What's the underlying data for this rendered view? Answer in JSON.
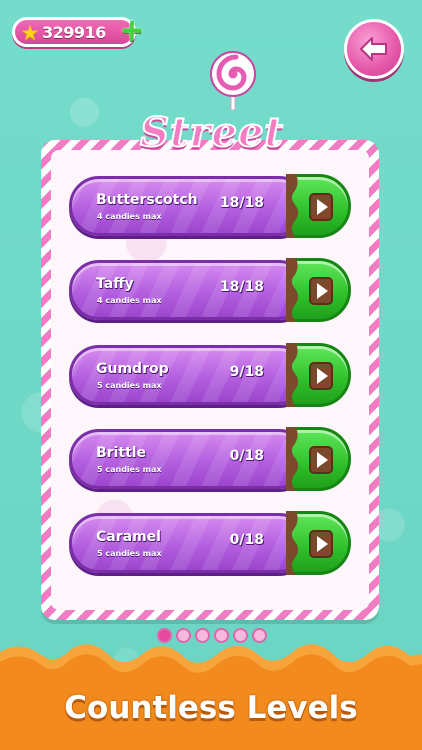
{
  "hud": {
    "coins": "329916",
    "star_icon": "star-icon",
    "plus_icon": "plus-icon",
    "back_icon": "back-arrow-icon"
  },
  "header": {
    "title": "Street",
    "logo_icon": "lollipop-icon"
  },
  "levels": [
    {
      "name": "Butterscotch",
      "subtitle": "4 candies max",
      "progress": "18/18"
    },
    {
      "name": "Taffy",
      "subtitle": "4 candies max",
      "progress": "18/18"
    },
    {
      "name": "Gumdrop",
      "subtitle": "5 candies max",
      "progress": "9/18"
    },
    {
      "name": "Brittle",
      "subtitle": "5 candies max",
      "progress": "0/18"
    },
    {
      "name": "Caramel",
      "subtitle": "5 candies max",
      "progress": "0/18"
    }
  ],
  "pagination": {
    "pages": 6,
    "current": 1
  },
  "footer": {
    "tagline": "Countless Levels"
  },
  "colors": {
    "background": "#6fd9c8",
    "panel_stripe": "#f07cc3",
    "pill": "#b35fdf",
    "play": "#2fc02a",
    "caramel": "#f28a1d"
  }
}
